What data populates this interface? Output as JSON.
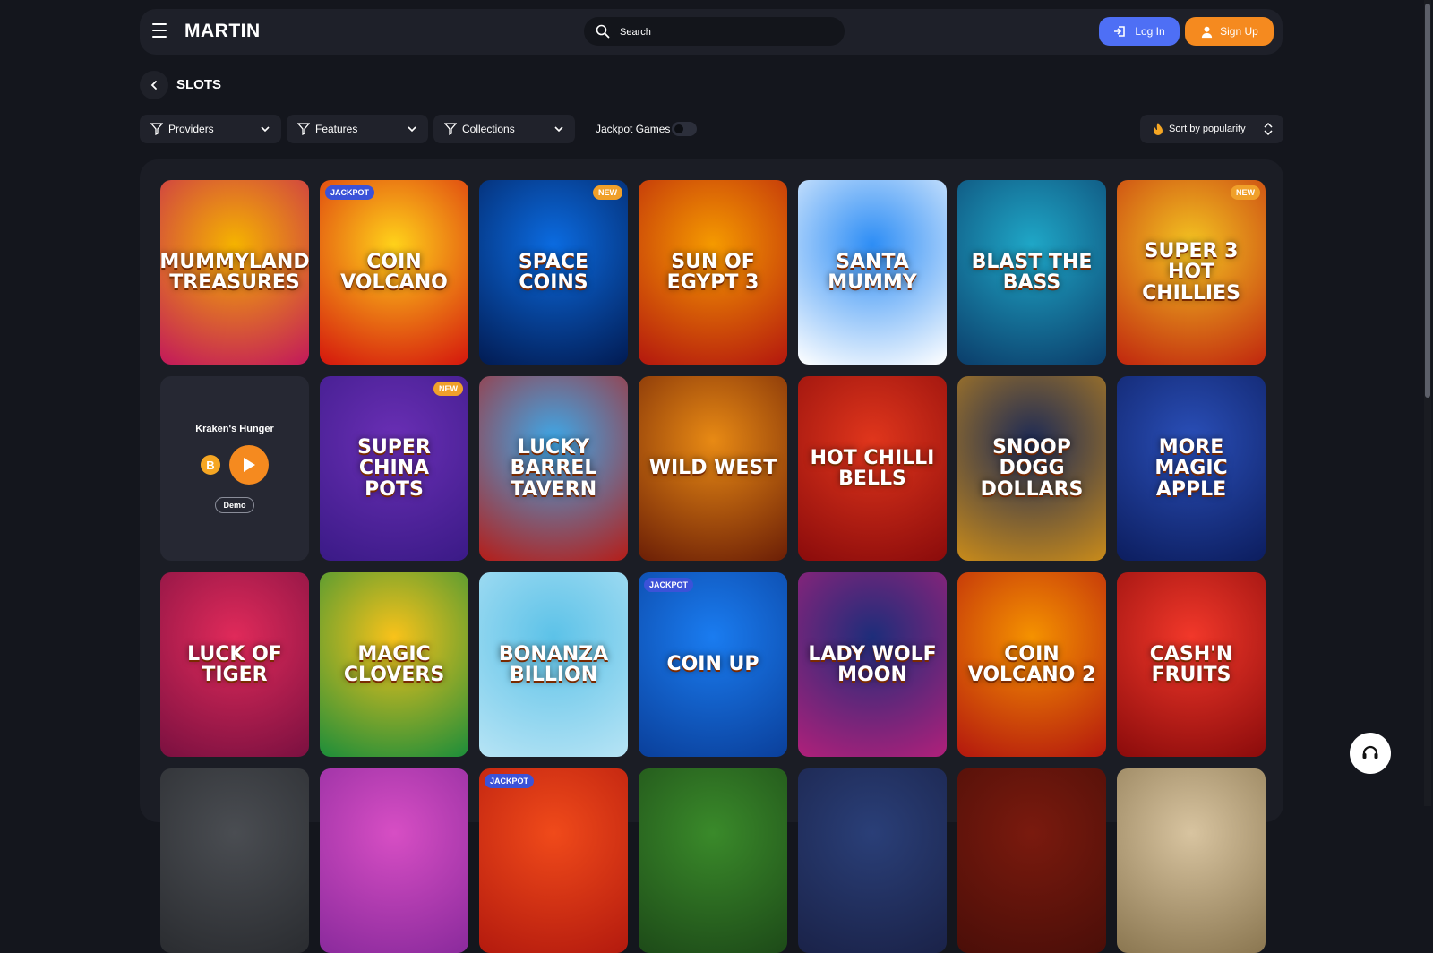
{
  "header": {
    "logo": "MARTIN",
    "search_placeholder": "Search",
    "login_label": "Log In",
    "signup_label": "Sign Up"
  },
  "page": {
    "title": "SLOTS"
  },
  "filters": {
    "providers": "Providers",
    "features": "Features",
    "collections": "Collections",
    "jackpot_label": "Jackpot Games",
    "jackpot_on": false,
    "sort_label": "Sort by popularity"
  },
  "games": [
    {
      "name": "Mummyland Treasures",
      "badge": "",
      "bg": [
        "#f5b300",
        "#c2185b"
      ]
    },
    {
      "name": "Coin Volcano",
      "badge": "JACKPOT",
      "bg": [
        "#ffd21a",
        "#d4160d"
      ]
    },
    {
      "name": "Space Coins",
      "badge": "NEW",
      "bg": [
        "#0b6be0",
        "#021b52"
      ]
    },
    {
      "name": "Sun of Egypt 3",
      "badge": "",
      "bg": [
        "#f59a00",
        "#b3170e"
      ]
    },
    {
      "name": "Santa Mummy",
      "badge": "",
      "bg": [
        "#2d8df5",
        "#ffffff"
      ]
    },
    {
      "name": "Blast the Bass",
      "badge": "",
      "bg": [
        "#1fa7c7",
        "#0b3d6a"
      ]
    },
    {
      "name": "Super 3 Hot Chillies",
      "badge": "NEW",
      "bg": [
        "#f3c321",
        "#c0260e"
      ]
    },
    {
      "name": "Kraken's Hunger",
      "badge": "",
      "demo": true
    },
    {
      "name": "Super China Pots",
      "badge": "NEW",
      "bg": [
        "#6a2fb5",
        "#3a1a86"
      ]
    },
    {
      "name": "Lucky Barrel Tavern",
      "badge": "",
      "bg": [
        "#3ea8e8",
        "#b51d18"
      ]
    },
    {
      "name": "Wild West",
      "badge": "",
      "bg": [
        "#e88a14",
        "#6b1e06"
      ]
    },
    {
      "name": "Hot Chilli Bells",
      "badge": "",
      "bg": [
        "#e0361c",
        "#8a0b0b"
      ]
    },
    {
      "name": "Snoop Dogg Dollars",
      "badge": "",
      "bg": [
        "#1d2a55",
        "#c98b1a"
      ]
    },
    {
      "name": "More Magic Apple",
      "badge": "",
      "bg": [
        "#2a4fb8",
        "#0c1d5e"
      ]
    },
    {
      "name": "Luck of Tiger",
      "badge": "",
      "bg": [
        "#e02a5a",
        "#7a1040"
      ]
    },
    {
      "name": "Magic Clovers",
      "badge": "",
      "bg": [
        "#f9c21a",
        "#1b8d3a"
      ]
    },
    {
      "name": "Bonanza Billion",
      "badge": "",
      "bg": [
        "#5cc2e8",
        "#b7e4f5"
      ]
    },
    {
      "name": "Coin Up",
      "badge": "JACKPOT",
      "bg": [
        "#1a7cf0",
        "#0a3f9a"
      ]
    },
    {
      "name": "Lady Wolf Moon",
      "badge": "",
      "bg": [
        "#1d2d7a",
        "#b0207a"
      ]
    },
    {
      "name": "Coin Volcano 2",
      "badge": "",
      "bg": [
        "#f59200",
        "#b3170e"
      ]
    },
    {
      "name": "Cash'n Fruits",
      "badge": "",
      "bg": [
        "#f2382a",
        "#8a0b0b"
      ]
    },
    {
      "name": "",
      "badge": "",
      "bg": [
        "#4a4d52",
        "#2a2c30"
      ]
    },
    {
      "name": "",
      "badge": "",
      "bg": [
        "#d74ec4",
        "#8a2a9c"
      ]
    },
    {
      "name": "",
      "badge": "JACKPOT",
      "bg": [
        "#f04a1a",
        "#b31a0e"
      ]
    },
    {
      "name": "",
      "badge": "",
      "bg": [
        "#3a8a2a",
        "#1d4a18"
      ]
    },
    {
      "name": "",
      "badge": "",
      "bg": [
        "#2a3f78",
        "#1a2248"
      ]
    },
    {
      "name": "",
      "badge": "",
      "bg": [
        "#7a1a0e",
        "#4a0e08"
      ]
    },
    {
      "name": "",
      "badge": "",
      "bg": [
        "#d8c4a0",
        "#8a7650"
      ]
    }
  ],
  "demo": {
    "title": "Kraken's Hunger",
    "label": "Demo",
    "coin": "B"
  },
  "colors": {
    "accent_blue": "#4e6ff5",
    "accent_orange": "#f58a1f"
  }
}
